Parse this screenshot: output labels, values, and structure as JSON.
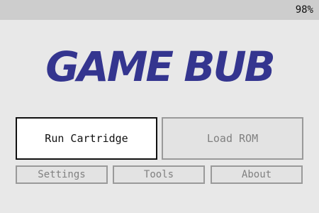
{
  "status_bar": {
    "battery": "98%"
  },
  "logo": {
    "text": "GAME BUB",
    "color": "#34358f"
  },
  "menu": {
    "run_cartridge": "Run Cartridge",
    "load_rom": "Load ROM",
    "settings": "Settings",
    "tools": "Tools",
    "about": "About",
    "selected": "Run Cartridge"
  }
}
